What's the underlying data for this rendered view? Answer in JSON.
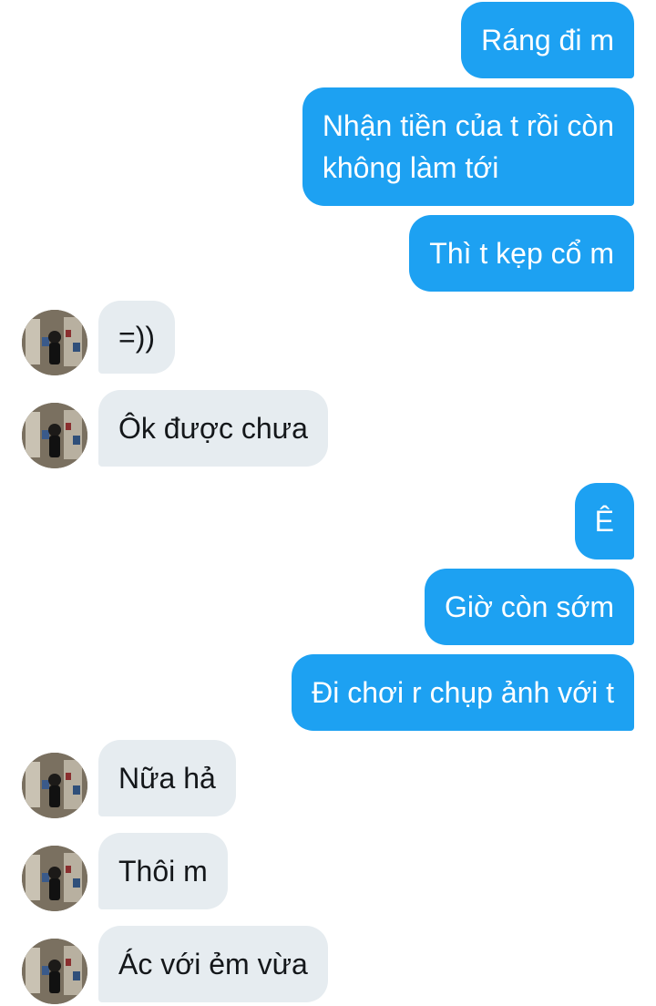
{
  "conversation": {
    "messages": [
      {
        "direction": "sent",
        "text": "Ráng đi m"
      },
      {
        "direction": "sent",
        "text": "Nhận tiền của t rồi còn\nkhông làm tới"
      },
      {
        "direction": "sent",
        "text": "Thì t kẹp cổ m"
      },
      {
        "direction": "received",
        "text": "=))"
      },
      {
        "direction": "received",
        "text": "Ôk được chưa"
      },
      {
        "direction": "sent",
        "text": "Ê"
      },
      {
        "direction": "sent",
        "text": "Giờ còn sớm"
      },
      {
        "direction": "sent",
        "text": "Đi chơi r chụp ảnh với t"
      },
      {
        "direction": "received",
        "text": "Nữa hả"
      },
      {
        "direction": "received",
        "text": "Thôi m"
      },
      {
        "direction": "received",
        "text": "Ác với ẻm vừa"
      }
    ]
  },
  "colors": {
    "sent_bubble": "#1da1f2",
    "received_bubble": "#e6ecf0",
    "background": "#ffffff"
  },
  "icons": {
    "avatar": "contact-avatar-photo"
  }
}
